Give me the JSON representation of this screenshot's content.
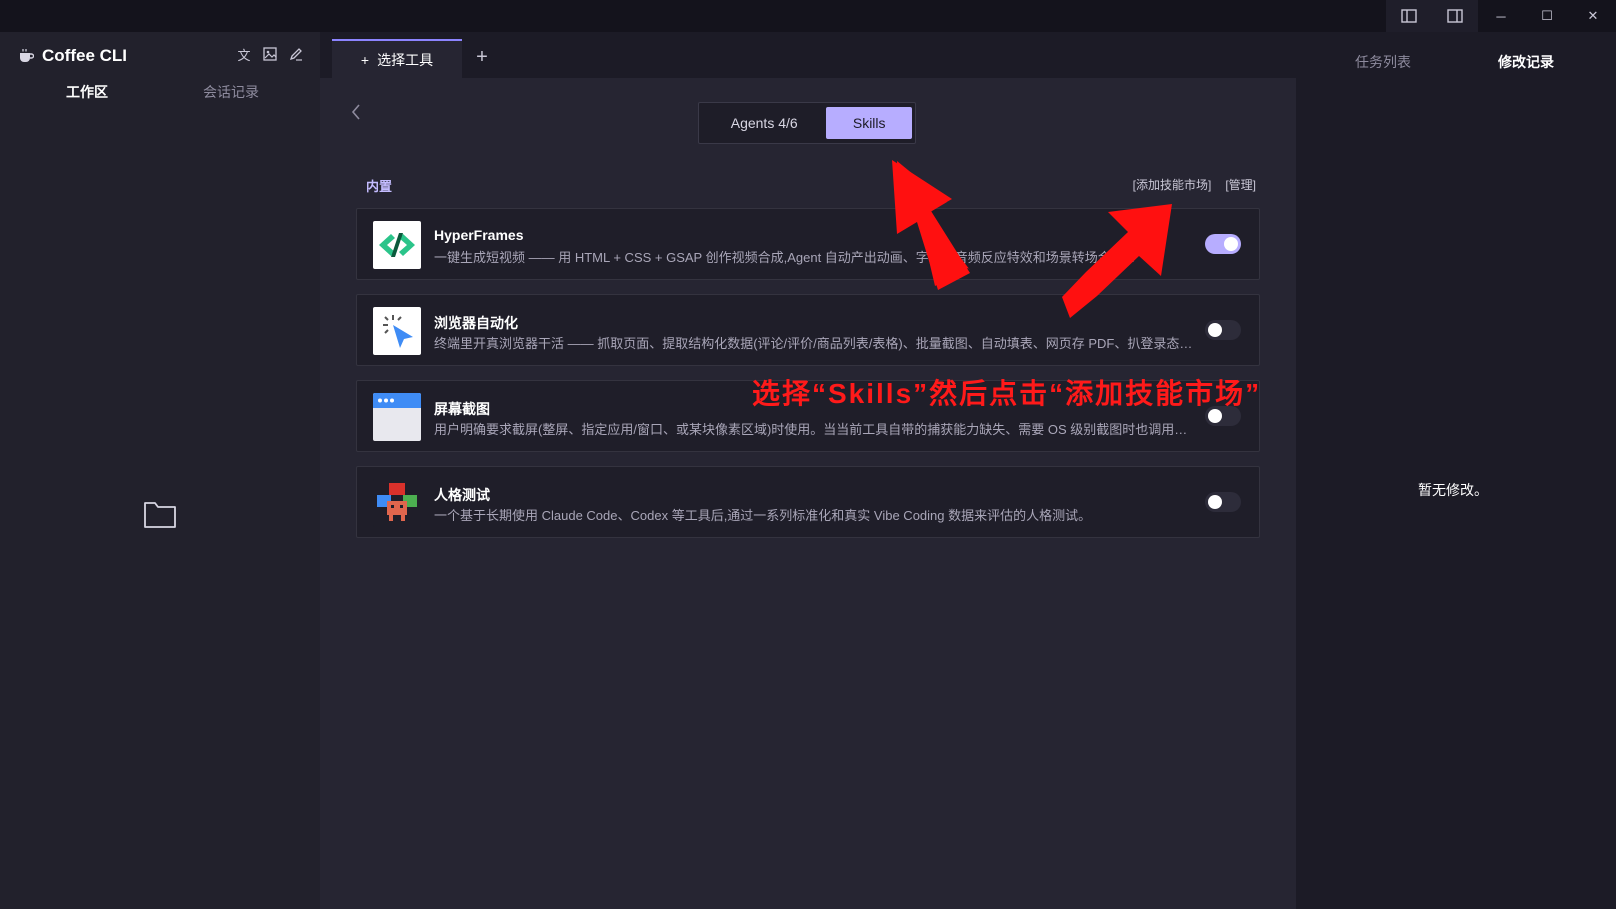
{
  "app": {
    "title": "Coffee CLI"
  },
  "window_controls": {
    "icons": [
      "layout-left-icon",
      "layout-right-icon",
      "minimize-icon",
      "maximize-icon",
      "close-icon"
    ],
    "minimize": "─",
    "maximize": "☐",
    "close": "✕"
  },
  "sidebar": {
    "tools": [
      "文",
      "🖼",
      "✎"
    ],
    "tabs": {
      "workspace": "工作区",
      "history": "会话记录"
    }
  },
  "tabbar": {
    "active_tab": "选择工具",
    "active_tab_prefix": "+",
    "add": "+"
  },
  "selector": {
    "agents": "Agents 4/6",
    "skills": "Skills",
    "selected": "Skills"
  },
  "section": {
    "title": "内置",
    "add_market": "[添加技能市场]",
    "manage": "[管理]"
  },
  "skills": [
    {
      "name": "HyperFrames",
      "desc": "一键生成短视频 —— 用 HTML + CSS + GSAP 创作视频合成,Agent 自动产出动画、字幕、音频反应特效和场景转场合成...",
      "enabled": true
    },
    {
      "name": "浏览器自动化",
      "desc": "终端里开真浏览器干活 —— 抓取页面、提取结构化数据(评论/评价/商品列表/表格)、批量截图、自动填表、网页存 PDF、扒登录态后才...",
      "enabled": false
    },
    {
      "name": "屏幕截图",
      "desc": "用户明确要求截屏(整屏、指定应用/窗口、或某块像素区域)时使用。当当前工具自带的捕获能力缺失、需要 OS 级别截图时也调用本技...",
      "enabled": false
    },
    {
      "name": "人格测试",
      "desc": "一个基于长期使用 Claude Code、Codex 等工具后,通过一系列标准化和真实 Vibe Coding 数据来评估的人格测试。",
      "enabled": false
    }
  ],
  "right_panel": {
    "tabs": {
      "tasks": "任务列表",
      "changes": "修改记录"
    },
    "empty": "暂无修改。"
  },
  "annotation": {
    "text": "选择“Skills”然后点击“添加技能市场”",
    "color": "#ff1a1a"
  },
  "colors": {
    "accent": "#b7adff",
    "background": "#1c1b26",
    "panel": "#262532"
  }
}
